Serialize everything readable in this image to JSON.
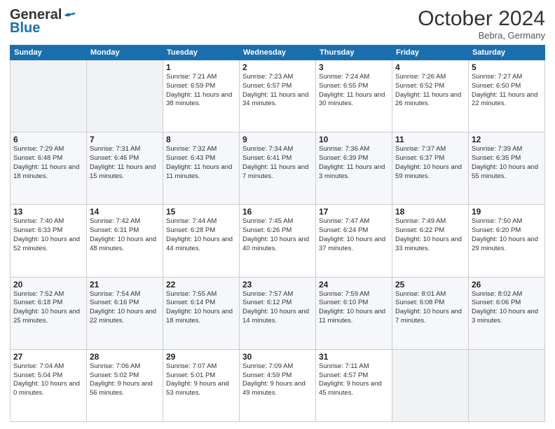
{
  "header": {
    "logo_general": "General",
    "logo_blue": "Blue",
    "month_title": "October 2024",
    "location": "Bebra, Germany"
  },
  "weekdays": [
    "Sunday",
    "Monday",
    "Tuesday",
    "Wednesday",
    "Thursday",
    "Friday",
    "Saturday"
  ],
  "weeks": [
    [
      {
        "day": "",
        "detail": ""
      },
      {
        "day": "",
        "detail": ""
      },
      {
        "day": "1",
        "detail": "Sunrise: 7:21 AM\nSunset: 6:59 PM\nDaylight: 11 hours and 38 minutes."
      },
      {
        "day": "2",
        "detail": "Sunrise: 7:23 AM\nSunset: 6:57 PM\nDaylight: 11 hours and 34 minutes."
      },
      {
        "day": "3",
        "detail": "Sunrise: 7:24 AM\nSunset: 6:55 PM\nDaylight: 11 hours and 30 minutes."
      },
      {
        "day": "4",
        "detail": "Sunrise: 7:26 AM\nSunset: 6:52 PM\nDaylight: 11 hours and 26 minutes."
      },
      {
        "day": "5",
        "detail": "Sunrise: 7:27 AM\nSunset: 6:50 PM\nDaylight: 11 hours and 22 minutes."
      }
    ],
    [
      {
        "day": "6",
        "detail": "Sunrise: 7:29 AM\nSunset: 6:48 PM\nDaylight: 11 hours and 18 minutes."
      },
      {
        "day": "7",
        "detail": "Sunrise: 7:31 AM\nSunset: 6:46 PM\nDaylight: 11 hours and 15 minutes."
      },
      {
        "day": "8",
        "detail": "Sunrise: 7:32 AM\nSunset: 6:43 PM\nDaylight: 11 hours and 11 minutes."
      },
      {
        "day": "9",
        "detail": "Sunrise: 7:34 AM\nSunset: 6:41 PM\nDaylight: 11 hours and 7 minutes."
      },
      {
        "day": "10",
        "detail": "Sunrise: 7:36 AM\nSunset: 6:39 PM\nDaylight: 11 hours and 3 minutes."
      },
      {
        "day": "11",
        "detail": "Sunrise: 7:37 AM\nSunset: 6:37 PM\nDaylight: 10 hours and 59 minutes."
      },
      {
        "day": "12",
        "detail": "Sunrise: 7:39 AM\nSunset: 6:35 PM\nDaylight: 10 hours and 55 minutes."
      }
    ],
    [
      {
        "day": "13",
        "detail": "Sunrise: 7:40 AM\nSunset: 6:33 PM\nDaylight: 10 hours and 52 minutes."
      },
      {
        "day": "14",
        "detail": "Sunrise: 7:42 AM\nSunset: 6:31 PM\nDaylight: 10 hours and 48 minutes."
      },
      {
        "day": "15",
        "detail": "Sunrise: 7:44 AM\nSunset: 6:28 PM\nDaylight: 10 hours and 44 minutes."
      },
      {
        "day": "16",
        "detail": "Sunrise: 7:45 AM\nSunset: 6:26 PM\nDaylight: 10 hours and 40 minutes."
      },
      {
        "day": "17",
        "detail": "Sunrise: 7:47 AM\nSunset: 6:24 PM\nDaylight: 10 hours and 37 minutes."
      },
      {
        "day": "18",
        "detail": "Sunrise: 7:49 AM\nSunset: 6:22 PM\nDaylight: 10 hours and 33 minutes."
      },
      {
        "day": "19",
        "detail": "Sunrise: 7:50 AM\nSunset: 6:20 PM\nDaylight: 10 hours and 29 minutes."
      }
    ],
    [
      {
        "day": "20",
        "detail": "Sunrise: 7:52 AM\nSunset: 6:18 PM\nDaylight: 10 hours and 25 minutes."
      },
      {
        "day": "21",
        "detail": "Sunrise: 7:54 AM\nSunset: 6:16 PM\nDaylight: 10 hours and 22 minutes."
      },
      {
        "day": "22",
        "detail": "Sunrise: 7:55 AM\nSunset: 6:14 PM\nDaylight: 10 hours and 18 minutes."
      },
      {
        "day": "23",
        "detail": "Sunrise: 7:57 AM\nSunset: 6:12 PM\nDaylight: 10 hours and 14 minutes."
      },
      {
        "day": "24",
        "detail": "Sunrise: 7:59 AM\nSunset: 6:10 PM\nDaylight: 10 hours and 11 minutes."
      },
      {
        "day": "25",
        "detail": "Sunrise: 8:01 AM\nSunset: 6:08 PM\nDaylight: 10 hours and 7 minutes."
      },
      {
        "day": "26",
        "detail": "Sunrise: 8:02 AM\nSunset: 6:06 PM\nDaylight: 10 hours and 3 minutes."
      }
    ],
    [
      {
        "day": "27",
        "detail": "Sunrise: 7:04 AM\nSunset: 5:04 PM\nDaylight: 10 hours and 0 minutes."
      },
      {
        "day": "28",
        "detail": "Sunrise: 7:06 AM\nSunset: 5:02 PM\nDaylight: 9 hours and 56 minutes."
      },
      {
        "day": "29",
        "detail": "Sunrise: 7:07 AM\nSunset: 5:01 PM\nDaylight: 9 hours and 53 minutes."
      },
      {
        "day": "30",
        "detail": "Sunrise: 7:09 AM\nSunset: 4:59 PM\nDaylight: 9 hours and 49 minutes."
      },
      {
        "day": "31",
        "detail": "Sunrise: 7:11 AM\nSunset: 4:57 PM\nDaylight: 9 hours and 45 minutes."
      },
      {
        "day": "",
        "detail": ""
      },
      {
        "day": "",
        "detail": ""
      }
    ]
  ]
}
